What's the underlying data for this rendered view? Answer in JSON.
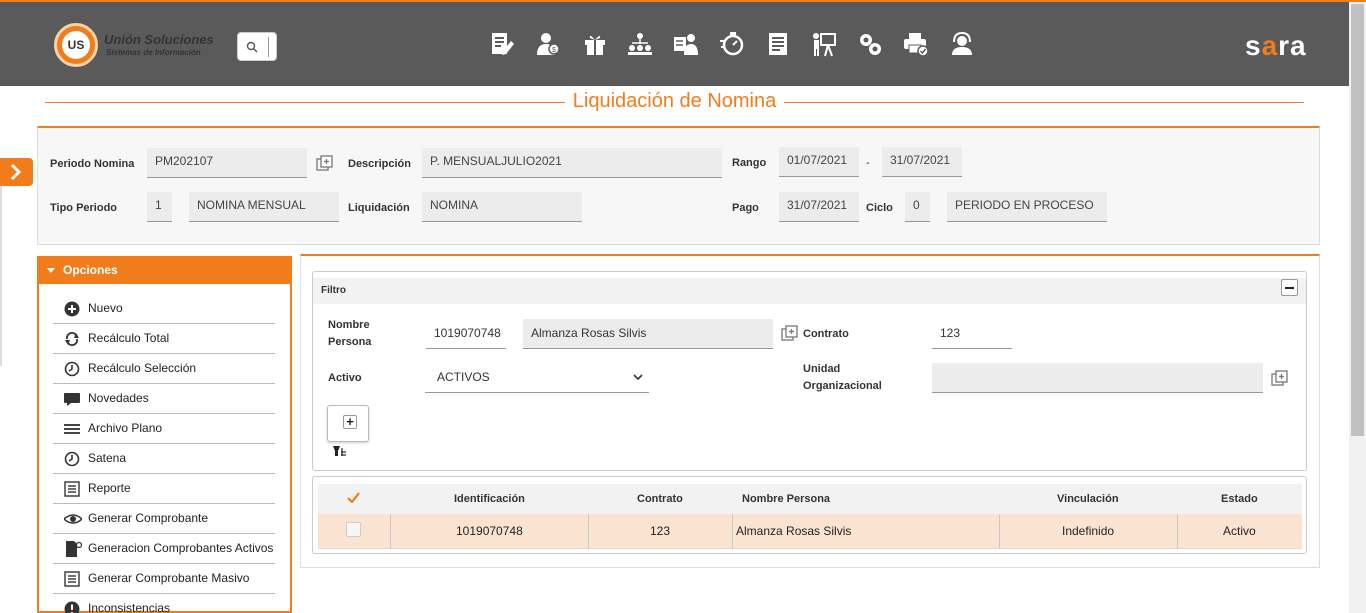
{
  "header": {
    "logo_badge": "US",
    "logo_title": "Unión Soluciones",
    "logo_subtitle": "Sistemas de Información",
    "brand": "sara",
    "nav_icons": [
      "document-edit-icon",
      "person-money-icon",
      "gift-icon",
      "hierarchy-icon",
      "person-card-icon",
      "timer-icon",
      "report-list-icon",
      "presentation-icon",
      "gears-icon",
      "printer-check-icon",
      "support-agent-icon"
    ]
  },
  "page": {
    "title": "Liquidación de Nomina"
  },
  "period": {
    "periodo_label": "Periodo Nomina",
    "periodo_value": "PM202107",
    "descripcion_label": "Descripción",
    "descripcion_value": "P. MENSUALJULIO2021",
    "rango_label": "Rango",
    "rango_desde": "01/07/2021",
    "rango_sep": "-",
    "rango_hasta": "31/07/2021",
    "tipo_label": "Tipo Periodo",
    "tipo_code": "1",
    "tipo_value": "NOMINA MENSUAL",
    "liquidacion_label": "Liquidación",
    "liquidacion_value": "NOMINA",
    "pago_label": "Pago",
    "pago_value": "31/07/2021",
    "ciclo_label": "Ciclo",
    "ciclo_value": "0",
    "estado_value": "PERIODO EN PROCESO"
  },
  "options": {
    "title": "Opciones",
    "items": [
      {
        "label": "Nuevo",
        "icon": "plus-circle-icon"
      },
      {
        "label": "Recálculo Total",
        "icon": "refresh-icon"
      },
      {
        "label": "Recálculo Selección",
        "icon": "clock-icon"
      },
      {
        "label": "Novedades",
        "icon": "comment-icon"
      },
      {
        "label": "Archivo Plano",
        "icon": "lines-icon"
      },
      {
        "label": "Satena",
        "icon": "clock-icon"
      },
      {
        "label": "Reporte",
        "icon": "list-alt-icon"
      },
      {
        "label": "Generar Comprobante",
        "icon": "eye-icon"
      },
      {
        "label": "Generacion Comprobantes Activos",
        "icon": "file-gear-icon"
      },
      {
        "label": "Generar Comprobante Masivo",
        "icon": "list-alt-icon"
      },
      {
        "label": "Inconsistencias",
        "icon": "warning-circle-icon"
      }
    ]
  },
  "filter": {
    "title": "Filtro",
    "nombre_label_1": "Nombre",
    "nombre_label_2": "Persona",
    "persona_id": "1019070748",
    "persona_nombre": "Almanza Rosas Silvis",
    "contrato_label": "Contrato",
    "contrato_value": "123",
    "activo_label": "Activo",
    "activo_value": "ACTIVOS",
    "unidad_label_1": "Unidad",
    "unidad_label_2": "Organizacional",
    "unidad_value": "",
    "add_label": "+"
  },
  "grid": {
    "columns": [
      "Identificación",
      "Contrato",
      "Nombre Persona",
      "Vinculación",
      "Estado"
    ],
    "rows": [
      {
        "identificacion": "1019070748",
        "contrato": "123",
        "nombre": "Almanza Rosas Silvis",
        "vinculacion": "Indefinido",
        "estado": "Activo"
      }
    ]
  },
  "colors": {
    "accent": "#f07c1c",
    "header_bg": "#5a5a5a",
    "row_selected": "#fbe3d2"
  }
}
